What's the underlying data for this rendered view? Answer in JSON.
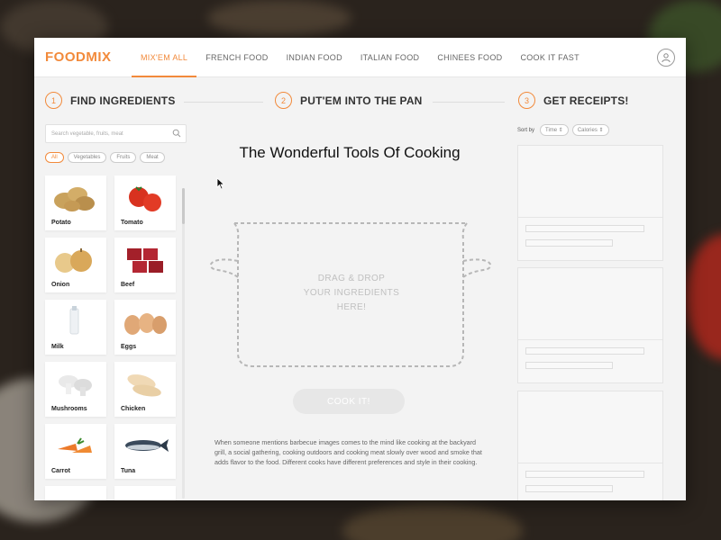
{
  "app": {
    "logo": "FOODMIX",
    "accent": "#f28a3b"
  },
  "nav": {
    "items": [
      "MIX'EM ALL",
      "FRENCH FOOD",
      "INDIAN FOOD",
      "ITALIAN FOOD",
      "CHINEES FOOD",
      "COOK IT FAST"
    ],
    "active": "MIX'EM ALL"
  },
  "steps": [
    {
      "num": "1",
      "label": "FIND INGREDIENTS"
    },
    {
      "num": "2",
      "label": "PUT'EM INTO THE PAN"
    },
    {
      "num": "3",
      "label": "GET RECEIPTS!"
    }
  ],
  "search": {
    "placeholder": "Search vegetable, fruits, meat",
    "icon": "search-icon"
  },
  "filters": [
    "All",
    "Vegetables",
    "Fruits",
    "Meat"
  ],
  "ingredients": [
    "Potato",
    "Tomato",
    "Onion",
    "Beef",
    "Milk",
    "Eggs",
    "Mushrooms",
    "Chicken",
    "Carrot",
    "Tuna"
  ],
  "center": {
    "title": "The Wonderful Tools Of Cooking",
    "drop_line1": "DRAG & DROP",
    "drop_line2": "YOUR INGREDIENTS",
    "drop_line3": "HERE!",
    "cook_button": "COOK IT!",
    "description": "When someone mentions barbecue images comes to the mind like cooking at the backyard grill, a social gathering, cooking outdoors and cooking meat slowly over wood and smoke that adds flavor to the food. Different cooks have different preferences and style in their cooking."
  },
  "sort": {
    "label": "Sort by",
    "options": [
      "Time",
      "Calories"
    ]
  }
}
